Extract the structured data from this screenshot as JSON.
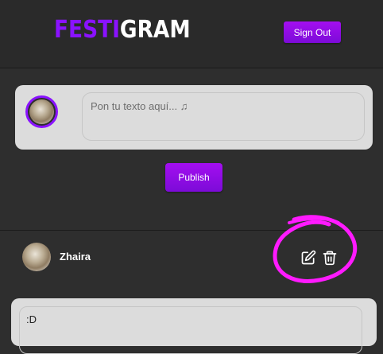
{
  "header": {
    "logo_part1": "FESTI",
    "logo_part2": "GRAM",
    "signout_label": "Sign Out"
  },
  "composer": {
    "placeholder": "Pon tu texto aquí... ♫",
    "publish_label": "Publish"
  },
  "post": {
    "username": "Zhaira",
    "content": ":D",
    "actions": [
      "edit-icon",
      "trash-icon"
    ]
  },
  "colors": {
    "accent": "#8a12ff",
    "button": "#9a0de8",
    "highlight": "#ff1aff",
    "background": "#2e2e2e"
  }
}
